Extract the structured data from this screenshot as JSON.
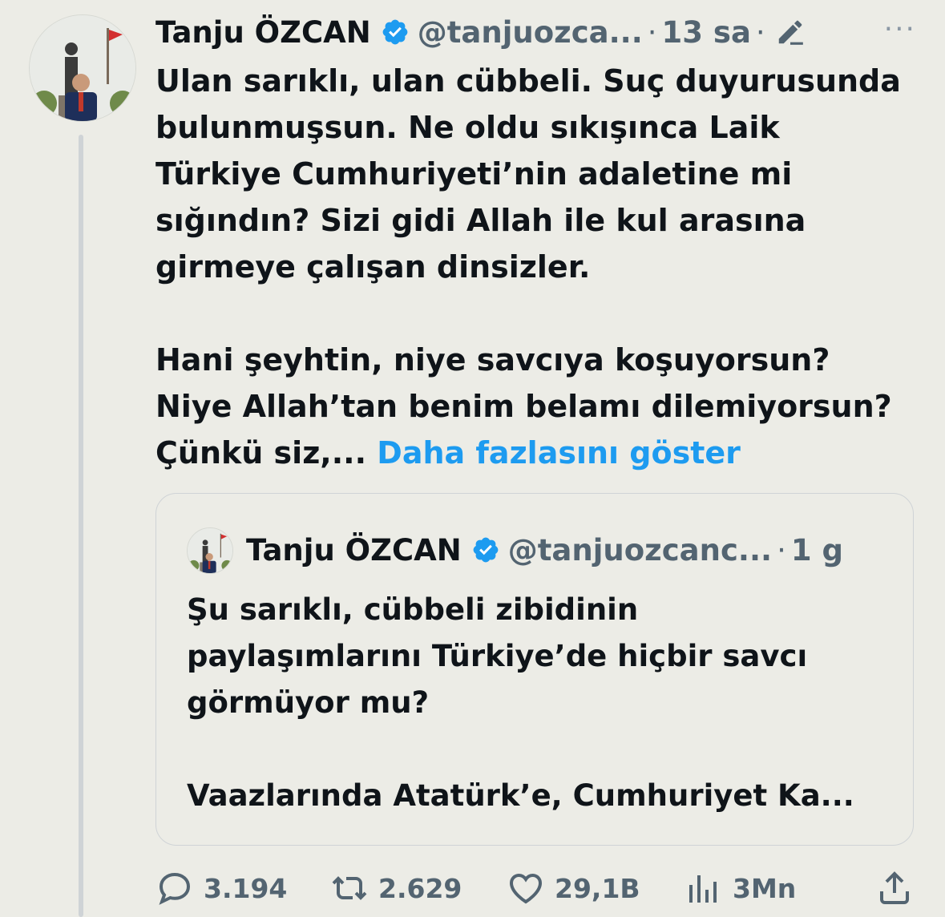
{
  "tweet": {
    "author_name": "Tanju ÖZCAN",
    "handle": "@tanjuozca...",
    "separator": "·",
    "time": "13 sa",
    "more_label": "···",
    "text": "Ulan sarıklı, ulan cübbeli. Suç duyurusunda\nbulunmuşsun. Ne oldu sıkışınca Laik\nTürkiye Cumhuriyeti’nin adaletine mi\nsığındın? Sizi gidi Allah ile kul arasına\ngirmeye çalışan dinsizler.\n\nHani şeyhtin, niye savcıya koşuyorsun?\nNiye Allah’tan benim belamı dilemiyorsun?\nÇünkü siz,... ",
    "show_more": "Daha fazlasını göster"
  },
  "quoted_tweet": {
    "author_name": "Tanju ÖZCAN",
    "handle": "@tanjuozcanc...",
    "separator": "·",
    "time": "1 g",
    "text": "Şu sarıklı, cübbeli zibidinin\npaylaşımlarını Türkiye’de hiçbir savcı\ngörmüyor mu?\n\nVaazlarında Atatürk’e, Cumhuriyet Ka..."
  },
  "actions": {
    "replies": "3.194",
    "retweets": "2.629",
    "likes": "29,1B",
    "views": "3Mn"
  },
  "icons": {
    "verified": "verified-badge-icon",
    "edit": "edited-pencil-icon",
    "reply": "reply-icon",
    "retweet": "retweet-icon",
    "like": "heart-icon",
    "views": "views-icon",
    "share": "share-icon"
  },
  "colors": {
    "background": "#ecece6",
    "text": "#0f1419",
    "muted": "#536471",
    "link": "#1d9bf0",
    "verified": "#1d9bf0"
  }
}
